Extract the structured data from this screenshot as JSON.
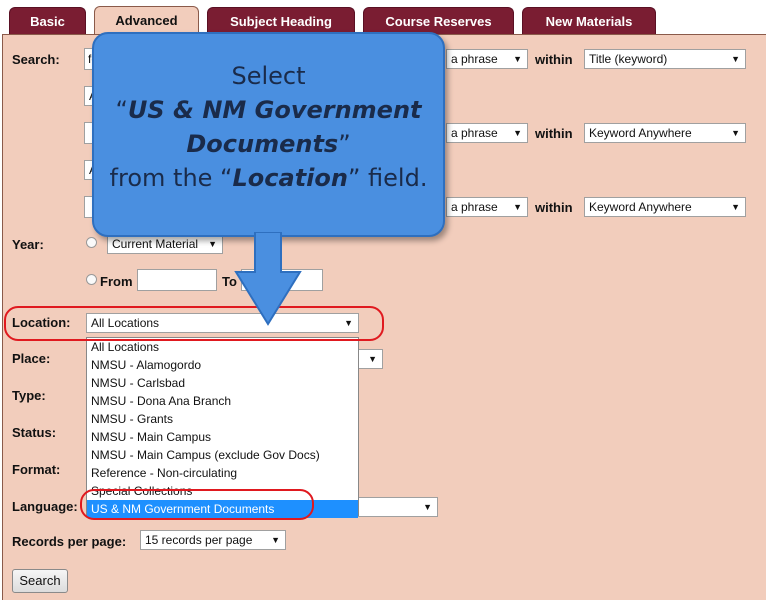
{
  "tabs": [
    "Basic",
    "Advanced",
    "Subject Heading",
    "Course Reserves",
    "New Materials"
  ],
  "labels": {
    "search": "Search:",
    "year": "Year:",
    "location": "Location:",
    "place": "Place:",
    "type": "Type:",
    "status": "Status:",
    "format": "Format:",
    "language": "Language:",
    "records": "Records per page:",
    "within": "within",
    "from": "From",
    "to": "To"
  },
  "search_rows": [
    {
      "term": "fe",
      "mode": "a phrase",
      "field": "Title (keyword)"
    },
    {
      "term": "",
      "mode": "a phrase",
      "field": "Keyword Anywhere"
    },
    {
      "term": "",
      "mode": "a phrase",
      "field": "Keyword Anywhere"
    }
  ],
  "bool_stub": "A",
  "year_select": "Current Material",
  "location_selected": "All Locations",
  "location_options": [
    "All Locations",
    "NMSU - Alamogordo",
    "NMSU - Carlsbad",
    "NMSU - Dona Ana Branch",
    "NMSU - Grants",
    "NMSU - Main Campus",
    "NMSU - Main Campus (exclude Gov Docs)",
    "Reference - Non-circulating",
    "Special Collections",
    "US & NM Government Documents"
  ],
  "highlighted_option": "US & NM Government Documents",
  "records_per_page": "15 records per page",
  "search_button": "Search",
  "callout": {
    "line1": "Select",
    "line2": "US & NM Government",
    "line3": "Documents",
    "line4a": "from the ",
    "line4b": "Location",
    "line4c": " field."
  },
  "colors": {
    "tab": "#7a1d32",
    "panel": "#f2cdbc",
    "callout": "#4a8fe0",
    "highlight": "#1e90ff",
    "ring": "#e0191f"
  }
}
